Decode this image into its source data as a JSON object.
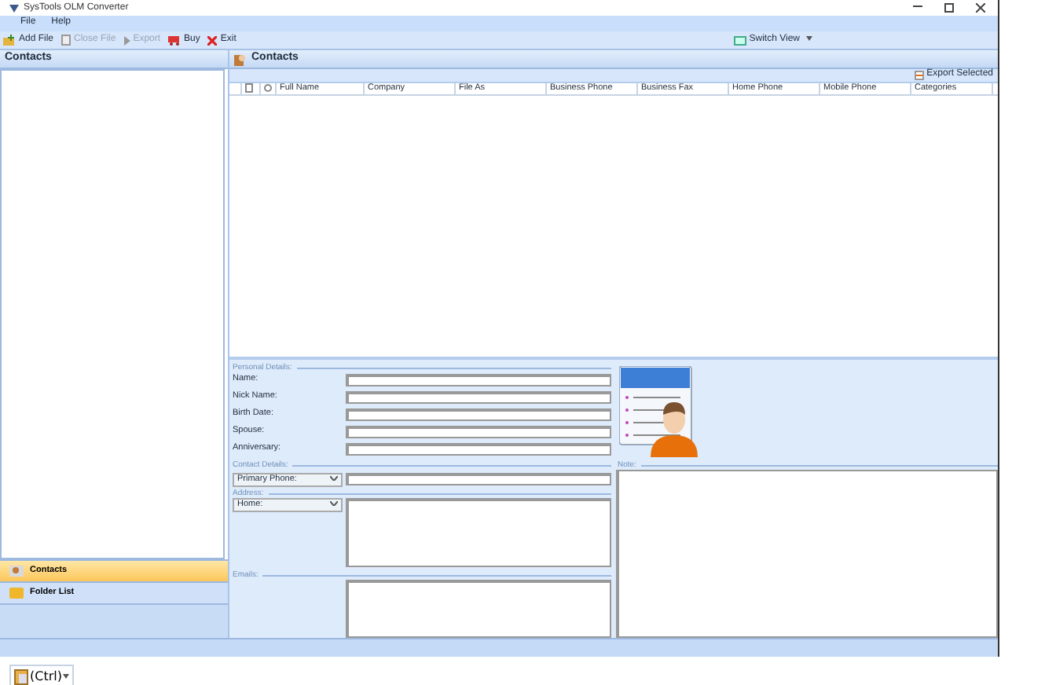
{
  "window": {
    "title": "SysTools OLM Converter"
  },
  "menu": [
    "File",
    "Help"
  ],
  "toolbar": [
    {
      "kind": "add",
      "label": "Add File",
      "disabled": false
    },
    {
      "kind": "close",
      "label": "Close File",
      "disabled": true
    },
    {
      "kind": "export",
      "label": "Export",
      "disabled": true
    },
    {
      "kind": "buy",
      "label": "Buy",
      "disabled": false
    },
    {
      "kind": "exit",
      "label": "Exit",
      "disabled": false
    }
  ],
  "switch_view": "Switch View",
  "left_panel": {
    "title": "Contacts",
    "nav": [
      {
        "kind": "contacts",
        "label": "Contacts",
        "selected": true
      },
      {
        "kind": "folder",
        "label": "Folder List",
        "selected": false
      }
    ]
  },
  "contacts": {
    "title": "Contacts",
    "export_button": "Export Selected",
    "columns": [
      "Full Name",
      "Company",
      "File As",
      "Business Phone",
      "Business Fax",
      "Home Phone",
      "Mobile Phone",
      "Categories"
    ]
  },
  "details": {
    "personal_section": "Personal Details:",
    "personal_fields": [
      "Name:",
      "Nick Name:",
      "Birth Date:",
      "Spouse:",
      "Anniversary:"
    ],
    "contact_section": "Contact Details:",
    "phone_select": "Primary Phone:",
    "address_section": "Address:",
    "address_select": "Home:",
    "emails_label": "Emails:",
    "note_label": "Note:"
  },
  "paste_button": "(Ctrl)"
}
